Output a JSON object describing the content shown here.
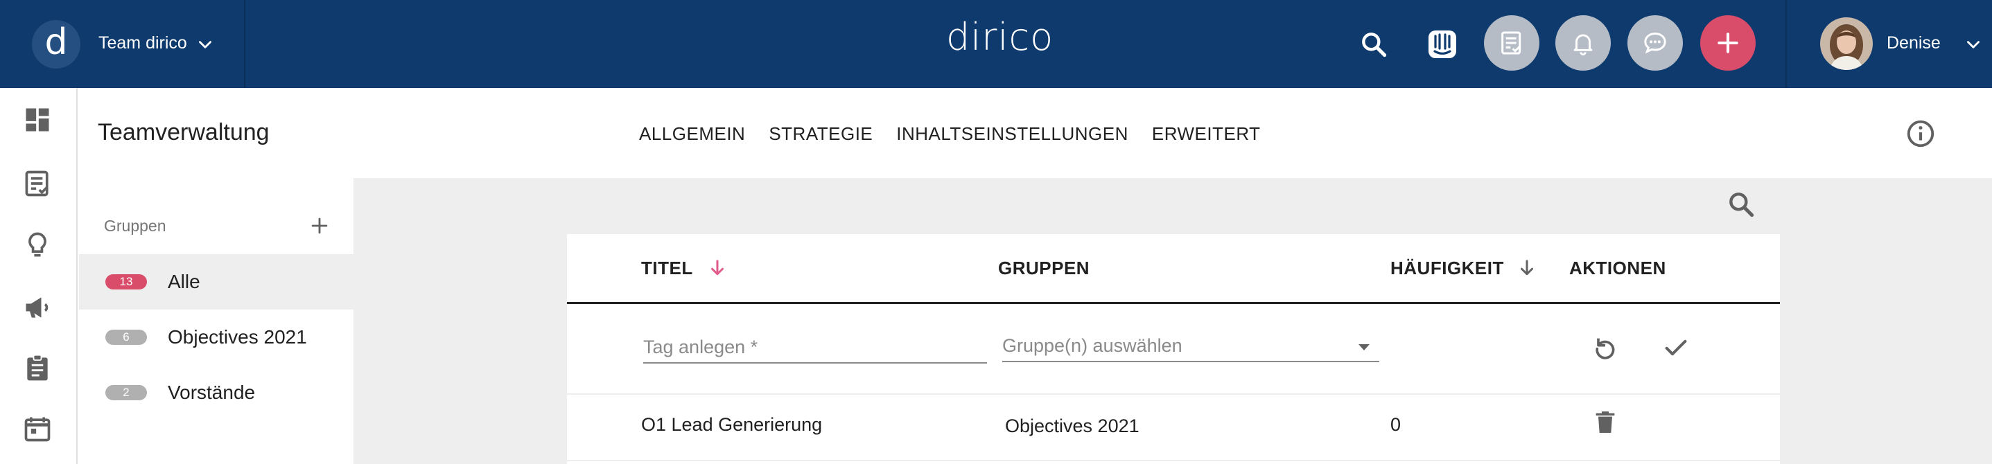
{
  "topbar": {
    "team_name": "Team dirico",
    "team_logo_letter": "d",
    "brand": "dirico",
    "user_name": "Denise",
    "colors": {
      "bar": "#0e3a6d",
      "accent_red": "#d94d6a",
      "grey_button": "#b5bcc6"
    },
    "icons": [
      "search-icon",
      "intercom-icon",
      "task-check-icon",
      "bell-icon",
      "chat-icon",
      "plus-icon"
    ]
  },
  "rail": {
    "icons": [
      "dashboard-icon",
      "content-check-icon",
      "lightbulb-icon",
      "megaphone-icon",
      "clipboard-icon",
      "calendar-icon"
    ]
  },
  "header": {
    "title": "Teamverwaltung",
    "tabs": [
      {
        "label": "ALLGEMEIN"
      },
      {
        "label": "STRATEGIE"
      },
      {
        "label": "INHALTSEINSTELLUNGEN"
      },
      {
        "label": "ERWEITERT"
      }
    ]
  },
  "groups": {
    "heading": "Gruppen",
    "items": [
      {
        "count": "13",
        "label": "Alle",
        "badge_color": "#d94d6a"
      },
      {
        "count": "6",
        "label": "Objectives 2021",
        "badge_color": "#b0b0b0"
      },
      {
        "count": "2",
        "label": "Vorstände",
        "badge_color": "#b0b0b0"
      }
    ]
  },
  "table": {
    "columns": {
      "title": "TITEL",
      "groups": "GRUPPEN",
      "frequency": "HÄUFIGKEIT",
      "actions": "AKTIONEN"
    },
    "new_row": {
      "tag_placeholder": "Tag anlegen *",
      "group_placeholder": "Gruppe(n) auswählen"
    },
    "rows": [
      {
        "title": "O1 Lead Generierung",
        "groups": "Objectives 2021",
        "frequency": "0"
      }
    ]
  }
}
